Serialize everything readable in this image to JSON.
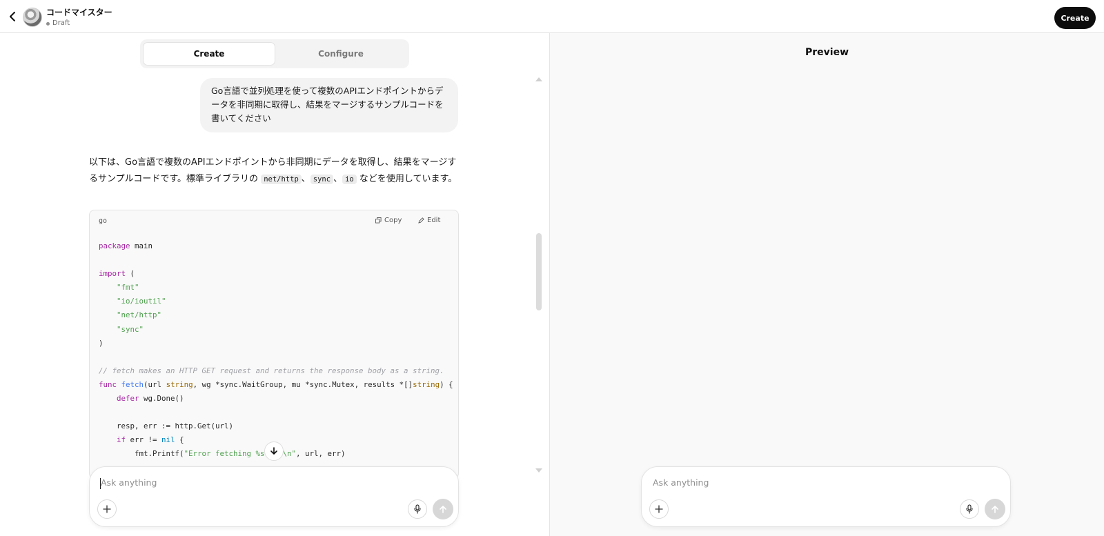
{
  "header": {
    "app_title": "コードマイスター",
    "status": "Draft",
    "create_button": "Create"
  },
  "builder": {
    "tabs": [
      {
        "label": "Create",
        "active": true
      },
      {
        "label": "Configure",
        "active": false
      }
    ],
    "user_message": "Go言語で並列処理を使って複数のAPIエンドポイントからデータを非同期に取得し、結果をマージするサンプルコードを書いてください",
    "answer": {
      "text_1": "以下は、Go言語で複数のAPIエンドポイントから非同期にデータを取得し、結果をマージするサンプルコードです。標準ライブラリの ",
      "code_1": "net/http",
      "sep_1": "、",
      "code_2": "sync",
      "sep_2": "、",
      "code_3": "io",
      "text_2": " などを使用しています。"
    },
    "code_block": {
      "language": "go",
      "copy_label": "Copy",
      "edit_label": "Edit"
    },
    "composer": {
      "placeholder": "Ask anything"
    }
  },
  "preview": {
    "title": "Preview",
    "composer": {
      "placeholder": "Ask anything"
    }
  },
  "icons": {
    "back": "chevron-left-icon",
    "copy": "copy-icon",
    "edit": "pencil-icon",
    "plus": "plus-icon",
    "mic": "microphone-icon",
    "send": "arrow-up-icon",
    "scroll": "arrow-down-icon"
  }
}
